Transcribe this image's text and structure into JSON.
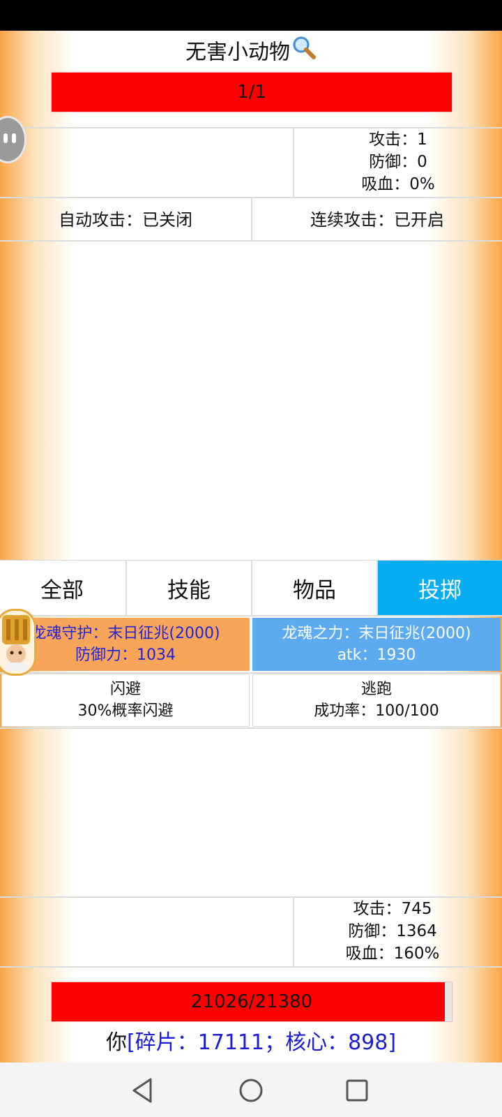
{
  "enemy": {
    "name": "无害小动物",
    "hp_text": "1/1",
    "hp_fraction": 1.0,
    "stats": {
      "attack": "攻击：1",
      "defense": "防御：0",
      "lifesteal": "吸血：0%"
    }
  },
  "toggles": {
    "auto_attack": "自动攻击：已关闭",
    "continuous_attack": "连续攻击：已开启"
  },
  "tabs": [
    {
      "label": "全部",
      "active": false
    },
    {
      "label": "技能",
      "active": false
    },
    {
      "label": "物品",
      "active": false
    },
    {
      "label": "投掷",
      "active": true
    }
  ],
  "skills": [
    {
      "line1": "龙魂守护：末日征兆(2000)",
      "line2": "防御力：1034",
      "bg": "#f8a55a",
      "color": "#2323d6"
    },
    {
      "line1": "龙魂之力：末日征兆(2000)",
      "line2": "atk：1930",
      "bg": "#5caaf0",
      "color": "#ffffff"
    },
    {
      "line1": "闪避",
      "line2": "30%概率闪避",
      "bg": "#ffffff",
      "color": "#111111"
    },
    {
      "line1": "逃跑",
      "line2": "成功率：100/100",
      "bg": "#ffffff",
      "color": "#111111"
    }
  ],
  "player": {
    "stats": {
      "attack": "攻击：745",
      "defense": "防御：1364",
      "lifesteal": "吸血：160%"
    },
    "hp_text": "21026/21380",
    "hp_fraction": 0.9834,
    "name": "你",
    "currency": "[碎片：17111；核心：898]"
  },
  "colors": {
    "hp_red": "#ff0000",
    "active_tab": "#06aef1",
    "currency_blue": "#1b1bd8"
  },
  "icons": {
    "search": "magnifier-icon",
    "nav_back": "triangle",
    "nav_home": "circle",
    "nav_recent": "square"
  }
}
